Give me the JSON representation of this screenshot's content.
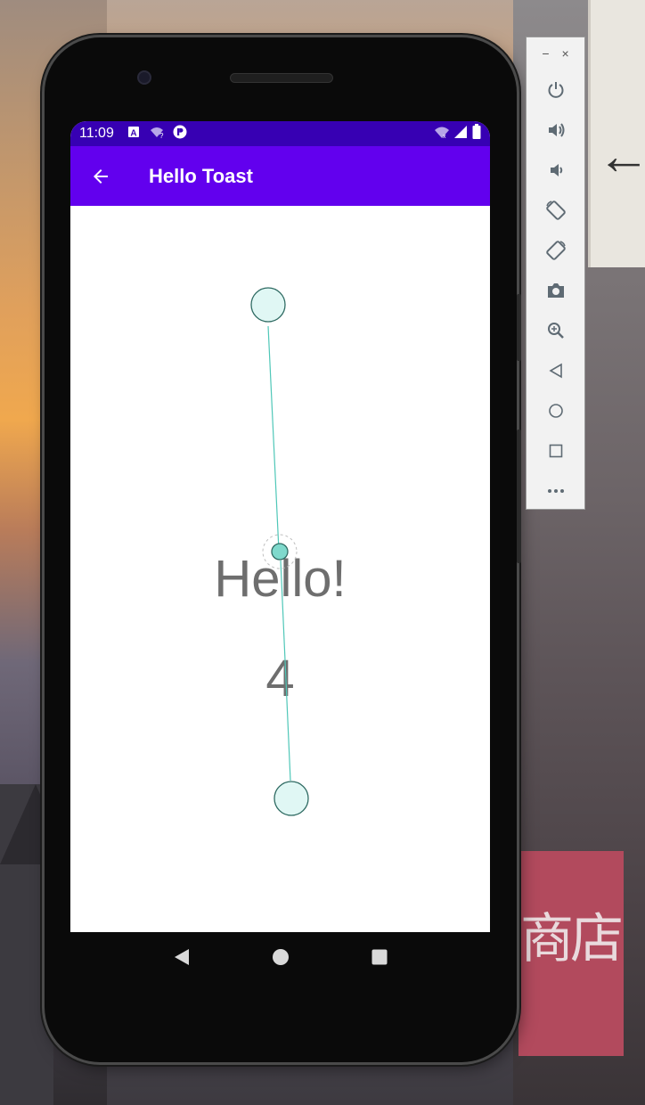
{
  "status_bar": {
    "time": "11:09",
    "left_icons": [
      "a-box-icon",
      "wifi-question-icon",
      "circle-p-icon"
    ],
    "right_icons": [
      "wifi-off-icon",
      "signal-icon",
      "battery-icon"
    ]
  },
  "app_bar": {
    "title": "Hello Toast",
    "back_icon": "arrow-left-icon"
  },
  "main": {
    "hello_text": "Hello!",
    "count_text": "4"
  },
  "nav_bar": {
    "buttons": [
      "back-triangle-icon",
      "home-circle-icon",
      "recents-square-icon"
    ]
  },
  "emulator_toolbar": {
    "window_controls": [
      "−",
      "×"
    ],
    "buttons": [
      "power-icon",
      "volume-up-icon",
      "volume-down-icon",
      "rotate-left-icon",
      "rotate-right-icon",
      "camera-icon",
      "zoom-icon",
      "back-icon",
      "home-icon",
      "overview-icon",
      "more-icon"
    ]
  },
  "colors": {
    "status_bar": "#3700b3",
    "app_bar": "#6200ee",
    "touch_point_fill": "#e0f7f4",
    "touch_line": "#4fc7b8"
  }
}
